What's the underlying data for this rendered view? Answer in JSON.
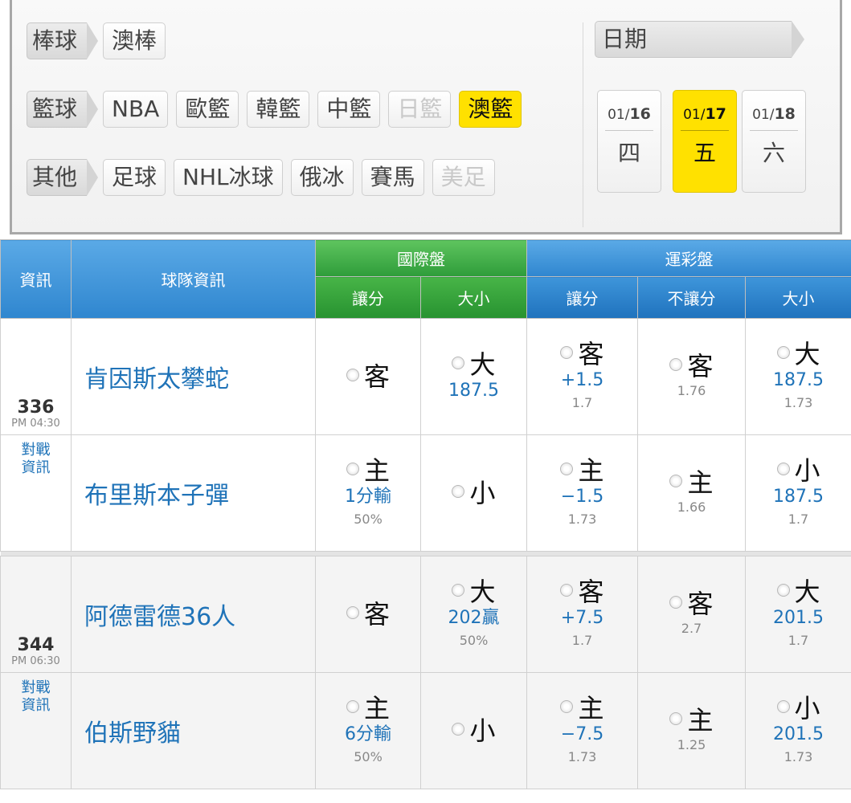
{
  "filters": {
    "rows": [
      {
        "tag": "棒球",
        "chips": [
          {
            "label": "澳棒",
            "state": "normal"
          }
        ]
      },
      {
        "tag": "籃球",
        "chips": [
          {
            "label": "NBA",
            "state": "normal"
          },
          {
            "label": "歐籃",
            "state": "normal"
          },
          {
            "label": "韓籃",
            "state": "normal"
          },
          {
            "label": "中籃",
            "state": "normal"
          },
          {
            "label": "日籃",
            "state": "disabled"
          },
          {
            "label": "澳籃",
            "state": "active"
          }
        ]
      },
      {
        "tag": "其他",
        "chips": [
          {
            "label": "足球",
            "state": "normal"
          },
          {
            "label": "NHL冰球",
            "state": "normal"
          },
          {
            "label": "俄冰",
            "state": "normal"
          },
          {
            "label": "賽馬",
            "state": "normal"
          },
          {
            "label": "美足",
            "state": "disabled"
          }
        ]
      }
    ],
    "date_label": "日期",
    "days": [
      {
        "month": "01/",
        "day": "16",
        "weekday": "四",
        "active": false
      },
      {
        "month": "01/",
        "day": "17",
        "weekday": "五",
        "active": true
      },
      {
        "month": "01/",
        "day": "18",
        "weekday": "六",
        "active": false
      }
    ]
  },
  "table": {
    "headers": {
      "info": "資訊",
      "team": "球隊資訊",
      "intl": "國際盤",
      "intl_spread": "讓分",
      "intl_total": "大小",
      "lottery": "運彩盤",
      "lot_spread": "讓分",
      "lot_ml": "不讓分",
      "lot_total": "大小"
    },
    "games": [
      {
        "number": "336",
        "time": "PM 04:30",
        "link": "對戰\n資訊",
        "away": {
          "team": "肯因斯太攀蛇",
          "intl_spread": {
            "opt": "客",
            "line": "",
            "odd": ""
          },
          "intl_total": {
            "opt": "大",
            "line": "187.5",
            "odd": ""
          },
          "lot_spread": {
            "opt": "客",
            "line": "+1.5",
            "odd": "1.7"
          },
          "lot_ml": {
            "opt": "客",
            "odd": "1.76"
          },
          "lot_total": {
            "opt": "大",
            "line": "187.5",
            "odd": "1.73"
          }
        },
        "home": {
          "team": "布里斯本子彈",
          "intl_spread": {
            "opt": "主",
            "line": "1分輸",
            "odd": "50%"
          },
          "intl_total": {
            "opt": "小",
            "line": "",
            "odd": ""
          },
          "lot_spread": {
            "opt": "主",
            "line": "−1.5",
            "odd": "1.73"
          },
          "lot_ml": {
            "opt": "主",
            "odd": "1.66"
          },
          "lot_total": {
            "opt": "小",
            "line": "187.5",
            "odd": "1.7"
          }
        }
      },
      {
        "number": "344",
        "time": "PM 06:30",
        "link": "對戰\n資訊",
        "away": {
          "team": "阿德雷德36人",
          "intl_spread": {
            "opt": "客",
            "line": "",
            "odd": ""
          },
          "intl_total": {
            "opt": "大",
            "line": "202贏",
            "odd": "50%"
          },
          "lot_spread": {
            "opt": "客",
            "line": "+7.5",
            "odd": "1.7"
          },
          "lot_ml": {
            "opt": "客",
            "odd": "2.7"
          },
          "lot_total": {
            "opt": "大",
            "line": "201.5",
            "odd": "1.7"
          }
        },
        "home": {
          "team": "伯斯野貓",
          "intl_spread": {
            "opt": "主",
            "line": "6分輸",
            "odd": "50%"
          },
          "intl_total": {
            "opt": "小",
            "line": "",
            "odd": ""
          },
          "lot_spread": {
            "opt": "主",
            "line": "−7.5",
            "odd": "1.73"
          },
          "lot_ml": {
            "opt": "主",
            "odd": "1.25"
          },
          "lot_total": {
            "opt": "小",
            "line": "201.5",
            "odd": "1.73"
          }
        }
      }
    ]
  }
}
